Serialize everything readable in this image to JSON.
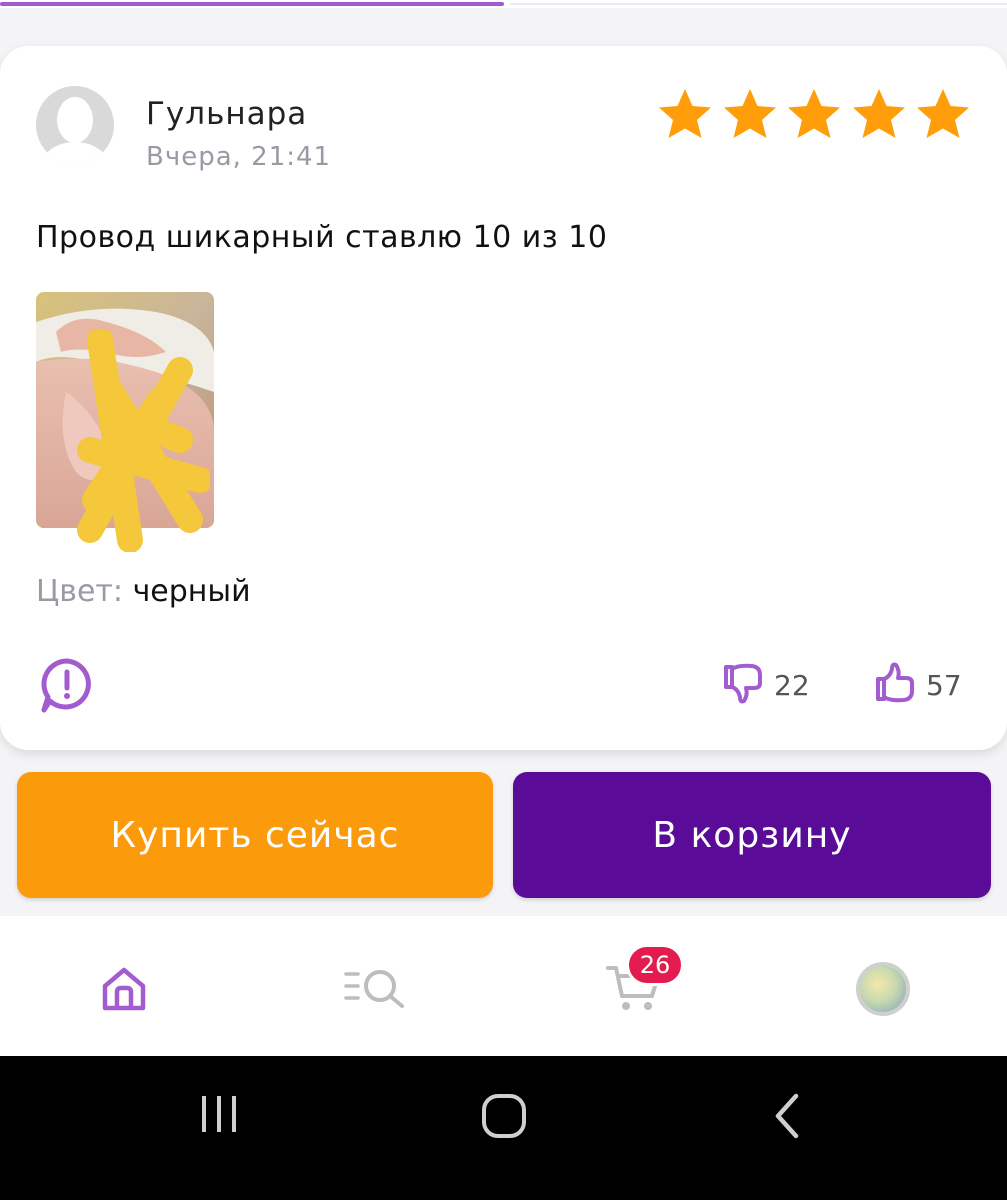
{
  "progress": {
    "fraction": 0.5
  },
  "review": {
    "author": "Гульнара",
    "date": "Вчера, 21:41",
    "rating": 5,
    "rating_max": 5,
    "text": "Провод шикарный ставлю 10 из 10",
    "color_label": "Цвет:",
    "color_value": "черный",
    "dislikes": "22",
    "likes": "57"
  },
  "actions": {
    "buy_now": "Купить сейчас",
    "add_to_cart": "В корзину"
  },
  "bottom_nav": {
    "items": [
      "home-icon",
      "catalog-search-icon",
      "cart-icon",
      "profile-avatar"
    ],
    "cart_badge": "26"
  },
  "colors": {
    "star": "#ff9d0a",
    "accent_purple": "#a35bd0",
    "buy_button": "#fb9a0b",
    "cart_button": "#5a0c99",
    "badge": "#e41b4f"
  }
}
